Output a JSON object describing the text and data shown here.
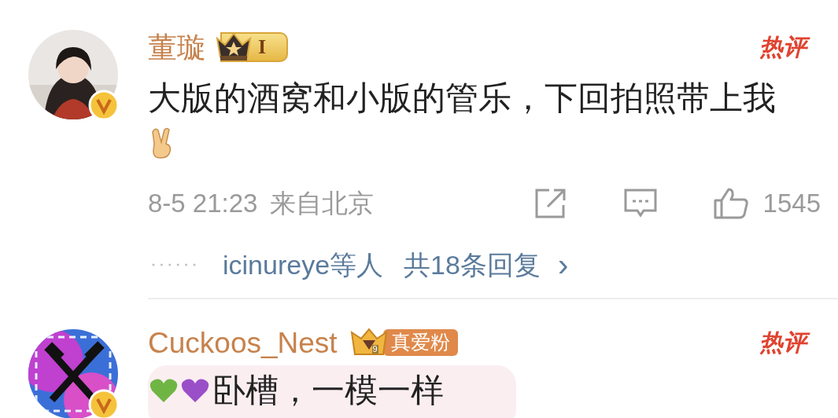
{
  "comments": [
    {
      "author": "董璇",
      "verified": true,
      "badge": {
        "kind": "crown",
        "label": "I"
      },
      "hot_label": "热评",
      "highlighted": false,
      "text": "大版的酒窝和小版的管乐，下回拍照带上我",
      "trailing_emoji": {
        "kind": "victory-hand"
      },
      "time": "8-5 21:23",
      "location": "来自北京",
      "likes": "1545",
      "replies": {
        "names": "icinureye等人",
        "count": "共18条回复",
        "arrow": "›"
      }
    },
    {
      "author": "Cuckoos_Nest",
      "verified": true,
      "badge": {
        "kind": "fan",
        "label": "真爱粉",
        "rank": "9"
      },
      "hot_label": "热评",
      "highlighted": true,
      "emojis": [
        {
          "kind": "heart",
          "color": "#6fb544"
        },
        {
          "kind": "heart",
          "color": "#9a4fc8"
        }
      ],
      "text": "卧槽，一模一样"
    }
  ]
}
